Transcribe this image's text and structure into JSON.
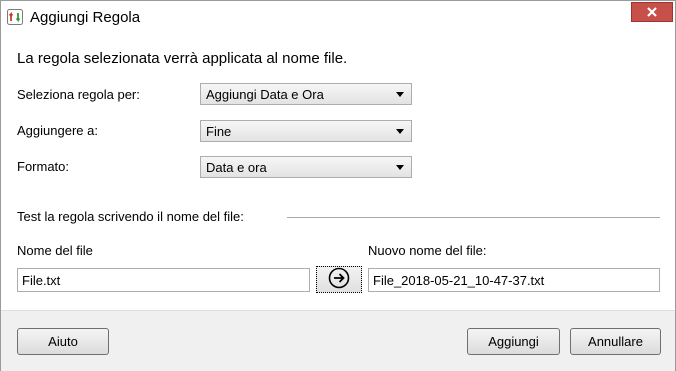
{
  "window": {
    "title": "Aggiungi Regola",
    "close_icon": "close-icon",
    "app_icon": "add-rule-icon"
  },
  "description": "La regola selezionata verrà applicata al nome file.",
  "rows": [
    {
      "label": "Seleziona regola per:",
      "value": "Aggiungi Data e Ora"
    },
    {
      "label": "Aggiungere a:",
      "value": "Fine"
    },
    {
      "label": "Formato:",
      "value": "Data e ora"
    }
  ],
  "test": {
    "label": "Test la regola scrivendo il nome del file:",
    "filename_label": "Nome del file",
    "filename_value": "File.txt",
    "new_filename_label": "Nuovo nome del file:",
    "new_filename_value": "File_2018-05-21_10-47-37.txt",
    "convert_icon": "arrow-right-circle-icon"
  },
  "footer": {
    "help_label": "Aiuto",
    "add_label": "Aggiungi",
    "cancel_label": "Annullare"
  },
  "colors": {
    "close_button": "#c7504a",
    "footer_bg": "#f0f0f0"
  }
}
